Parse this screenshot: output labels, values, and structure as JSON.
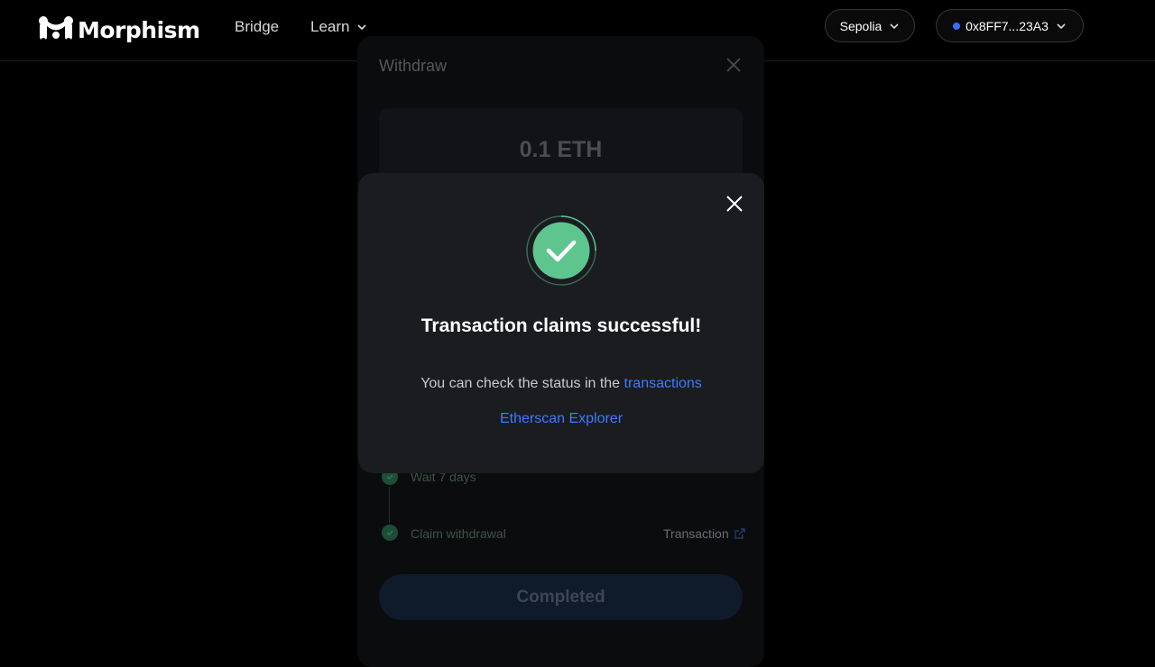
{
  "header": {
    "brand": "Morphism",
    "nav": {
      "bridge": "Bridge",
      "learn": "Learn"
    },
    "network": "Sepolia",
    "wallet": "0x8FF7...23A3"
  },
  "background_card": {
    "title": "Withdraw",
    "amount": "0.1 ETH",
    "steps": [
      {
        "label": "Wait 7 days"
      },
      {
        "label": "Claim withdrawal",
        "link": "Transaction"
      }
    ],
    "button": "Completed"
  },
  "modal": {
    "title": "Transaction claims successful!",
    "text_prefix": "You can check the status in the",
    "text_link": "transactions",
    "explorer_link": "Etherscan Explorer",
    "accent_color": "#5fc58f",
    "link_color": "#3d7bff"
  }
}
